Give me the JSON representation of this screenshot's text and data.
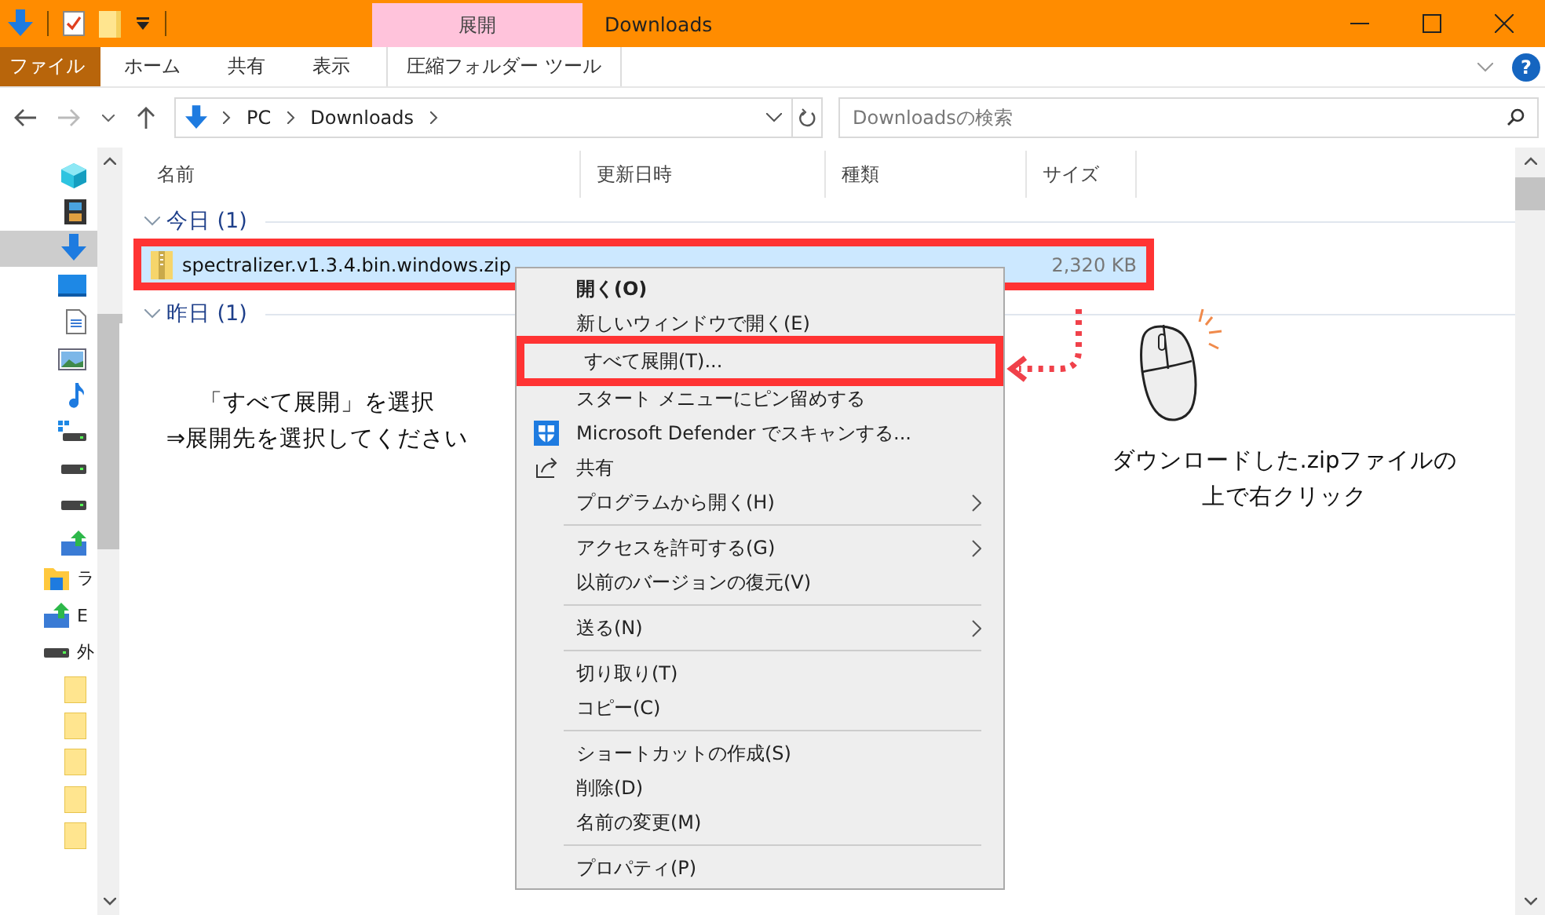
{
  "window": {
    "title": "Downloads",
    "context_tab": "展開"
  },
  "ribbon": {
    "tabs": [
      {
        "label": "ファイル",
        "kind": "file",
        "selected": false
      },
      {
        "label": "ホーム",
        "kind": "tab",
        "selected": false
      },
      {
        "label": "共有",
        "kind": "tab",
        "selected": false
      },
      {
        "label": "表示",
        "kind": "tab",
        "selected": false
      },
      {
        "label": "圧縮フォルダー ツール",
        "kind": "context",
        "selected": false
      }
    ],
    "help": "?"
  },
  "address": {
    "path": [
      "PC",
      "Downloads"
    ]
  },
  "search": {
    "placeholder": "Downloadsの検索"
  },
  "nav": {
    "items": [
      {
        "kind": "cube",
        "selected": false
      },
      {
        "kind": "film",
        "selected": false
      },
      {
        "kind": "download",
        "selected": true
      },
      {
        "kind": "desktop",
        "selected": false
      },
      {
        "kind": "document",
        "selected": false
      },
      {
        "kind": "picture",
        "selected": false
      },
      {
        "kind": "music",
        "selected": false
      },
      {
        "kind": "system-drive",
        "selected": false
      },
      {
        "kind": "drive",
        "selected": false
      },
      {
        "kind": "drive",
        "selected": false
      },
      {
        "kind": "net-drive",
        "selected": false
      },
      {
        "kind": "library",
        "label": "ラ",
        "selected": false
      },
      {
        "kind": "net-drive",
        "label": "E",
        "selected": false
      },
      {
        "kind": "drive",
        "label": "外",
        "selected": false
      },
      {
        "kind": "folder",
        "selected": false
      },
      {
        "kind": "folder",
        "selected": false
      },
      {
        "kind": "folder",
        "selected": false
      },
      {
        "kind": "folder",
        "selected": false
      },
      {
        "kind": "folder",
        "selected": false
      }
    ]
  },
  "columns": [
    "名前",
    "更新日時",
    "種類",
    "サイズ"
  ],
  "groups": [
    {
      "label": "今日 (1)",
      "files": [
        {
          "name": "spectralizer.v1.3.4.bin.windows.zip",
          "size": "2,320 KB",
          "selected": true,
          "highlighted": true
        }
      ]
    },
    {
      "label": "昨日 (1)"
    }
  ],
  "context_menu": {
    "items": [
      {
        "kind": "default",
        "label": "開く(O)",
        "submenu": false,
        "highlighted": false
      },
      {
        "kind": "item",
        "label": "新しいウィンドウで開く(E)",
        "submenu": false,
        "highlighted": false
      },
      {
        "kind": "item",
        "label": "すべて展開(T)...",
        "submenu": false,
        "highlighted": true
      },
      {
        "kind": "item",
        "label": "スタート メニューにピン留めする",
        "submenu": false,
        "highlighted": false
      },
      {
        "kind": "shield",
        "label": "Microsoft Defender でスキャンする...",
        "submenu": false,
        "highlighted": false
      },
      {
        "kind": "share",
        "label": "共有",
        "submenu": false,
        "highlighted": false
      },
      {
        "kind": "item",
        "label": "プログラムから開く(H)",
        "submenu": true,
        "highlighted": false
      },
      {
        "kind": "separator"
      },
      {
        "kind": "item",
        "label": "アクセスを許可する(G)",
        "submenu": true,
        "highlighted": false
      },
      {
        "kind": "item",
        "label": "以前のバージョンの復元(V)",
        "submenu": false,
        "highlighted": false
      },
      {
        "kind": "separator"
      },
      {
        "kind": "item",
        "label": "送る(N)",
        "submenu": true,
        "highlighted": false
      },
      {
        "kind": "separator"
      },
      {
        "kind": "item",
        "label": "切り取り(T)",
        "submenu": false,
        "highlighted": false
      },
      {
        "kind": "item",
        "label": "コピー(C)",
        "submenu": false,
        "highlighted": false
      },
      {
        "kind": "separator"
      },
      {
        "kind": "item",
        "label": "ショートカットの作成(S)",
        "submenu": false,
        "highlighted": false
      },
      {
        "kind": "item",
        "label": "削除(D)",
        "submenu": false,
        "highlighted": false
      },
      {
        "kind": "item",
        "label": "名前の変更(M)",
        "submenu": false,
        "highlighted": false
      },
      {
        "kind": "separator"
      },
      {
        "kind": "item",
        "label": "プロパティ(P)",
        "submenu": false,
        "highlighted": false
      }
    ]
  },
  "annotations": {
    "left_note": [
      "「すべて展開」を選択",
      "⇒展開先を選択してください"
    ],
    "right_note": [
      "ダウンロードした.zipファイルの",
      "上で右クリック"
    ]
  }
}
